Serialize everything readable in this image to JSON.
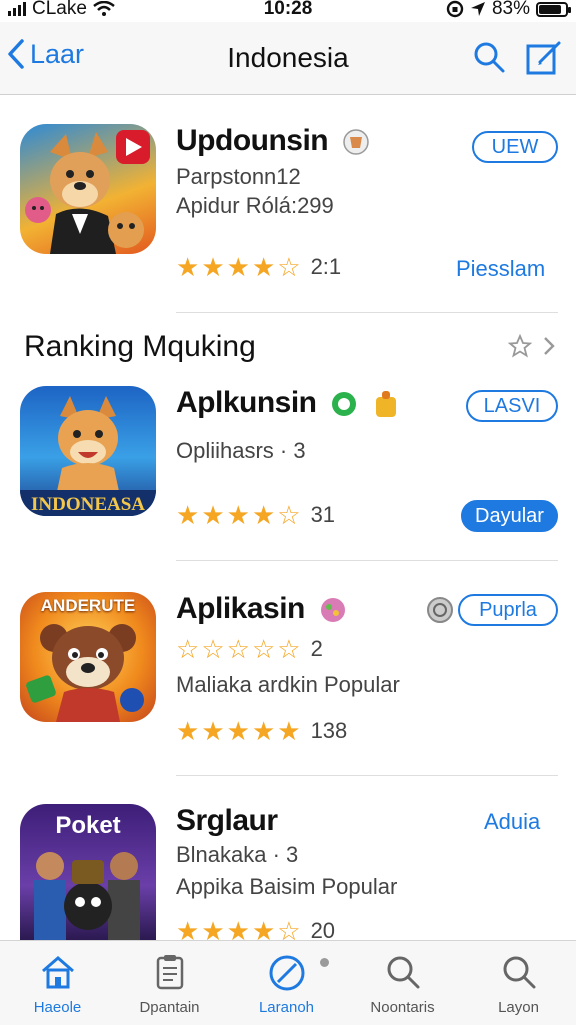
{
  "status": {
    "carrier": "CLake",
    "time": "10:28",
    "battery": "83%"
  },
  "nav": {
    "back_label": "Laar",
    "title": "Indonesia"
  },
  "apps": [
    {
      "name": "Updounsin",
      "sub1": "Parpstonn12",
      "sub2": "Apidur Rólá:299",
      "rating_count": "2:1",
      "action": "UEW",
      "link": "Piesslam",
      "rating": 4.5
    },
    {
      "name": "Aplkunsin",
      "sub1": "Opliihasrs · 3",
      "rating_count": "31",
      "action": "LASVI",
      "link": "Dayular",
      "icon_text": "INDONEASA",
      "rating": 4.5
    },
    {
      "name": "Aplikasin",
      "sub1": "Maliaka ardkin Popular",
      "rating_small_count": "2",
      "rating_count": "138",
      "action": "Puprla",
      "icon_text": "ANDERUTE",
      "rating": 5
    },
    {
      "name": "Srglaur",
      "sub1": "Blnakaka · 3",
      "sub2": "Appika Baisim Popular",
      "rating_count": "20",
      "action": "Aduia",
      "icon_text": "Poket",
      "rating": 4.5
    }
  ],
  "section": {
    "title": "Ranking Mquking"
  },
  "tabs": [
    {
      "label": "Haeole",
      "icon": "home-icon"
    },
    {
      "label": "Dpantain",
      "icon": "clipboard-icon"
    },
    {
      "label": "Laranoh",
      "icon": "compass-icon"
    },
    {
      "label": "Noontaris",
      "icon": "search-icon"
    },
    {
      "label": "Layon",
      "icon": "search-icon"
    }
  ],
  "colors": {
    "accent": "#1e7ae0",
    "star": "#f5a623"
  }
}
